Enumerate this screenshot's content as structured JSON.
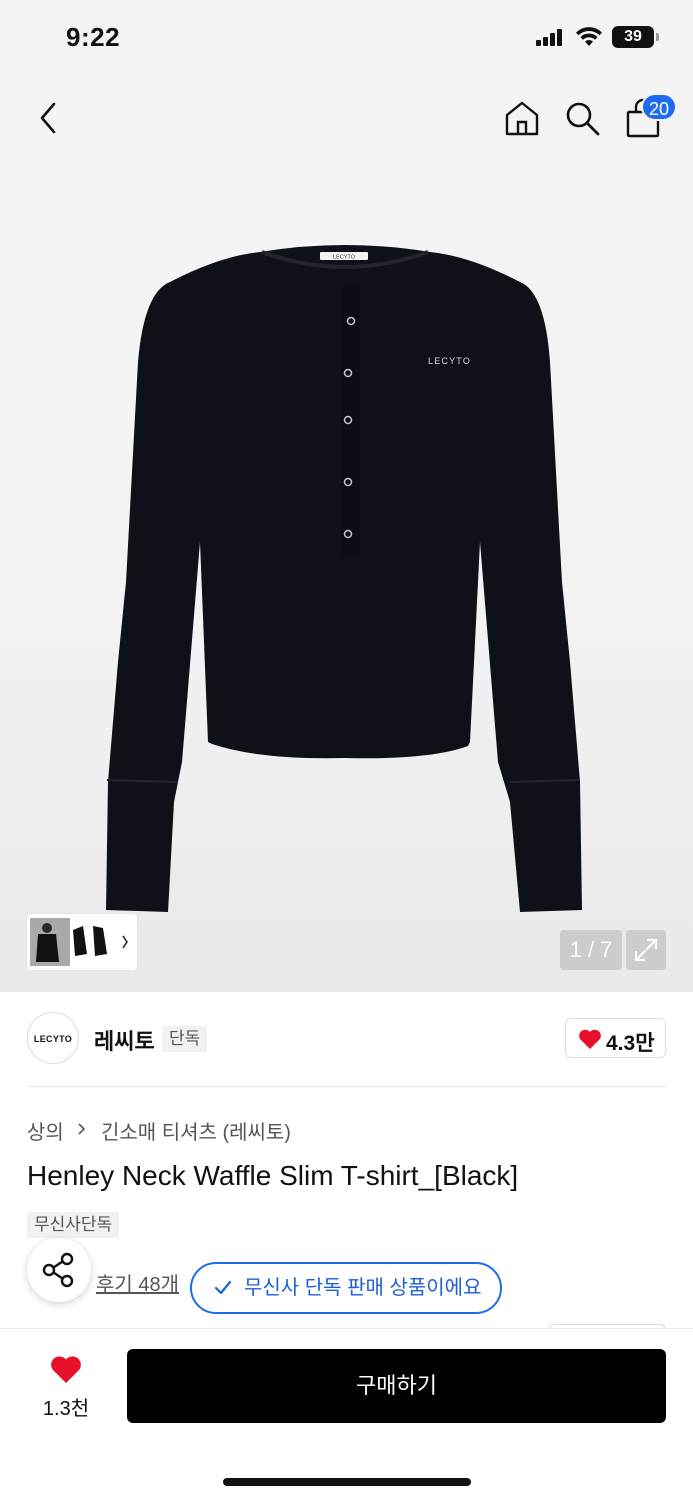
{
  "status_bar": {
    "time": "9:22",
    "battery": "39"
  },
  "header": {
    "cart_count": "20"
  },
  "gallery": {
    "counter": "1 / 7"
  },
  "brand": {
    "logo_text": "LECYTO",
    "name": "레씨토",
    "tag": "단독",
    "like_count": "4.3만"
  },
  "breadcrumb": {
    "items": [
      "상의",
      "긴소매 티셔츠 (레씨토)"
    ]
  },
  "product": {
    "title": "Henley Neck Waffle Slim T-shirt_[Black]",
    "exclusive_badge": "무신사단독",
    "review_link": "후기 48개",
    "exclusive_notice": "무신사 단독 판매 상품이에요",
    "shirt_label": "LECYTO",
    "neck_label": "LECYTO"
  },
  "bottom_bar": {
    "wish_count": "1.3천",
    "buy_label": "구매하기"
  },
  "colors": {
    "accent": "#1e6bf0",
    "heart": "#e8102a",
    "buy_button": "#000000"
  }
}
